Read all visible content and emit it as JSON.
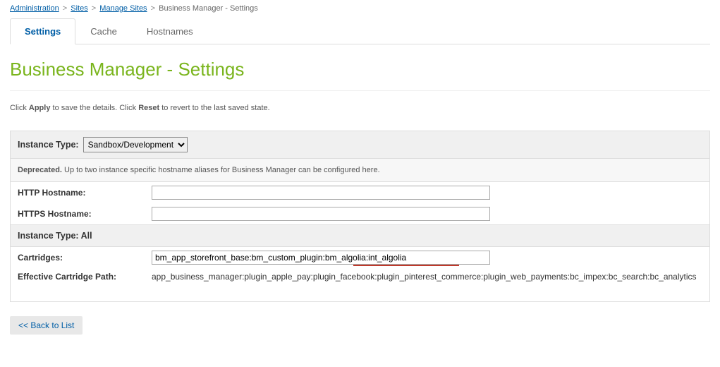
{
  "breadcrumb": {
    "admin": "Administration",
    "sites": "Sites",
    "manage": "Manage Sites",
    "current": "Business Manager - Settings"
  },
  "tabs": {
    "settings": "Settings",
    "cache": "Cache",
    "hostnames": "Hostnames"
  },
  "title": "Business Manager - Settings",
  "help": {
    "prefix": "Click ",
    "apply": "Apply",
    "mid": " to save the details. Click ",
    "reset": "Reset",
    "suffix": " to revert to the last saved state."
  },
  "instanceType": {
    "label": "Instance Type:",
    "selected": "Sandbox/Development"
  },
  "deprecated": {
    "label": "Deprecated.",
    "text": " Up to two instance specific hostname aliases for Business Manager can be configured here."
  },
  "fields": {
    "httpHostname": {
      "label": "HTTP Hostname:",
      "value": ""
    },
    "httpsHostname": {
      "label": "HTTPS Hostname:",
      "value": ""
    }
  },
  "allSection": {
    "header": "Instance Type:  All",
    "cartridgesLabel": "Cartridges:",
    "cartridgesValue": "bm_app_storefront_base:bm_custom_plugin:bm_algolia:int_algolia",
    "effectiveLabel": "Effective Cartridge Path:",
    "effectiveValue": "app_business_manager:plugin_apple_pay:plugin_facebook:plugin_pinterest_commerce:plugin_web_payments:bc_impex:bc_search:bc_analytics"
  },
  "back": "<< Back to List"
}
